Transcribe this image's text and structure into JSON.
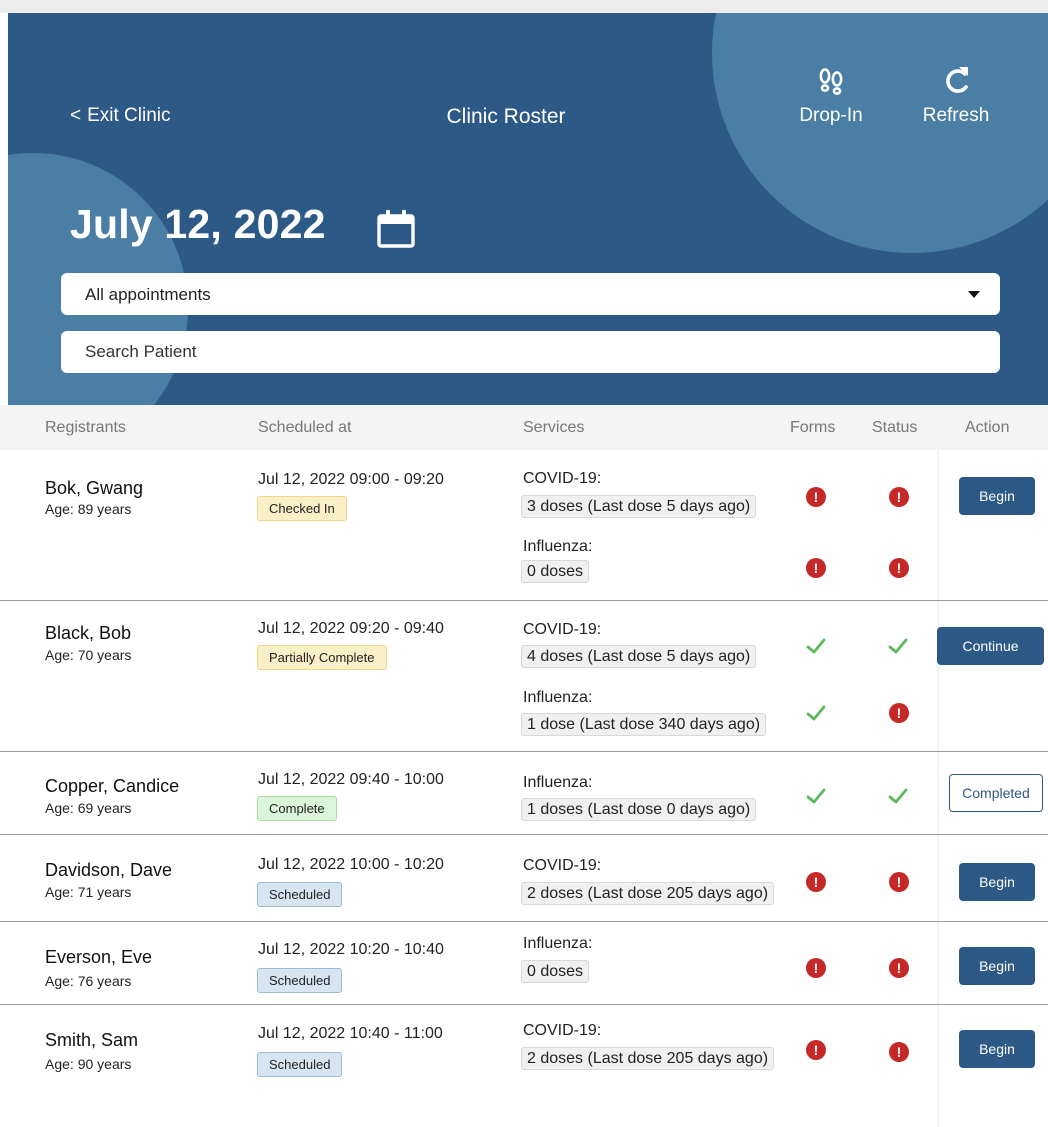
{
  "header": {
    "exit_label": "Exit Clinic",
    "exit_chevron": "<",
    "title": "Clinic Roster",
    "drop_in_label": "Drop-In",
    "refresh_label": "Refresh",
    "date": "July 12, 2022"
  },
  "filters": {
    "appointment_filter": "All appointments",
    "search_placeholder": "Search Patient"
  },
  "columns": {
    "registrants": "Registrants",
    "scheduled_at": "Scheduled at",
    "services": "Services",
    "forms": "Forms",
    "status": "Status",
    "action": "Action"
  },
  "rows": [
    {
      "name": "Bok, Gwang",
      "age": "Age: 89 years",
      "scheduled": "Jul 12, 2022  09:00 - 09:20",
      "badge": "Checked In",
      "services": [
        {
          "title": "COVID-19:",
          "doses": "3 doses (Last dose 5 days ago)",
          "forms": "alert",
          "status": "alert"
        },
        {
          "title": "Influenza:",
          "doses": "0 doses",
          "forms": "alert",
          "status": "alert"
        }
      ],
      "action": "Begin"
    },
    {
      "name": "Black, Bob",
      "age": "Age: 70 years",
      "scheduled": "Jul 12, 2022  09:20 - 09:40",
      "badge": "Partially Complete",
      "services": [
        {
          "title": "COVID-19:",
          "doses": "4 doses (Last dose 5 days ago)",
          "forms": "check",
          "status": "check"
        },
        {
          "title": "Influenza:",
          "doses": "1 dose (Last dose 340 days ago)",
          "forms": "check",
          "status": "alert"
        }
      ],
      "action": "Continue"
    },
    {
      "name": "Copper, Candice",
      "age": "Age: 69 years",
      "scheduled": "Jul 12, 2022  09:40 - 10:00",
      "badge": "Complete",
      "services": [
        {
          "title": "Influenza:",
          "doses": "1 doses (Last dose 0 days ago)",
          "forms": "check",
          "status": "check"
        }
      ],
      "action": "Completed"
    },
    {
      "name": "Davidson, Dave",
      "age": "Age: 71 years",
      "scheduled": "Jul 12, 2022  10:00 - 10:20",
      "badge": "Scheduled",
      "services": [
        {
          "title": "COVID-19:",
          "doses": "2 doses (Last dose 205 days ago)",
          "forms": "alert",
          "status": "alert"
        }
      ],
      "action": "Begin"
    },
    {
      "name": "Everson, Eve",
      "age": "Age: 76 years",
      "scheduled": "Jul 12, 2022  10:20 - 10:40",
      "badge": "Scheduled",
      "services": [
        {
          "title": "Influenza:",
          "doses": "0 doses",
          "forms": "alert",
          "status": "alert"
        }
      ],
      "action": "Begin"
    },
    {
      "name": "Smith, Sam",
      "age": "Age: 90 years",
      "scheduled": "Jul 12, 2022  10:40 - 11:00",
      "badge": "Scheduled",
      "services": [
        {
          "title": "COVID-19:",
          "doses": "2 doses (Last dose 205 days ago)",
          "forms": "alert",
          "status": "alert"
        }
      ],
      "action": "Begin"
    }
  ],
  "icons": {
    "drop_in": "footprints-icon",
    "refresh": "refresh-icon",
    "calendar": "calendar-icon",
    "alert": "exclamation-icon",
    "check": "checkmark-icon",
    "caret": "chevron-down-icon"
  },
  "colors": {
    "header_bg": "#2d5986",
    "header_circle": "#4a7ea4",
    "primary_button": "#2d5986",
    "alert": "#c62828",
    "check": "#5cb85c",
    "badge_yellow": "#fbefc8",
    "badge_green": "#dbf5d8",
    "badge_blue": "#d6e5f2"
  }
}
